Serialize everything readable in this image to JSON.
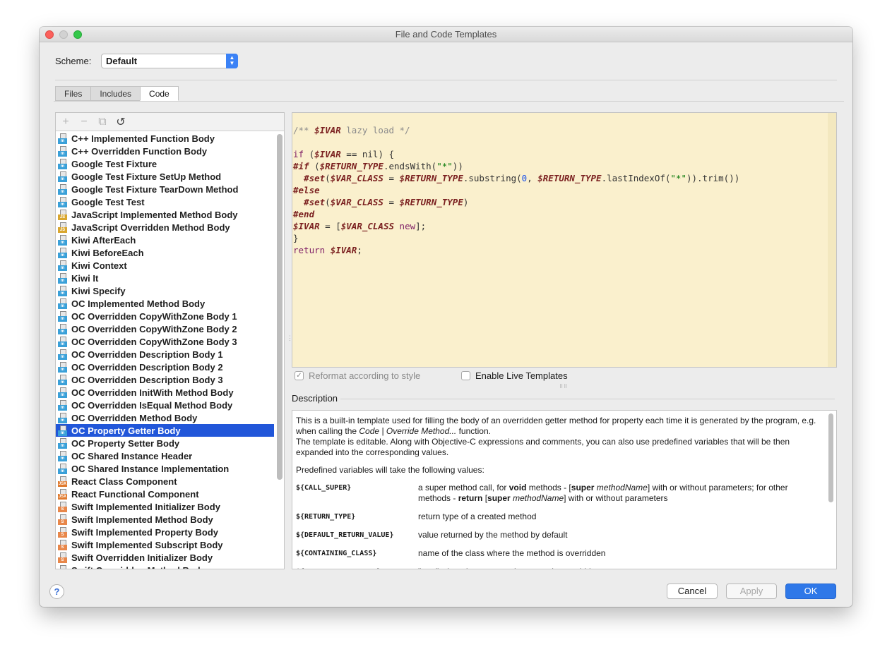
{
  "window": {
    "title": "File and Code Templates"
  },
  "scheme": {
    "label": "Scheme:",
    "value": "Default"
  },
  "tabs": [
    {
      "label": "Files",
      "active": false
    },
    {
      "label": "Includes",
      "active": false
    },
    {
      "label": "Code",
      "active": true
    }
  ],
  "toolbar": {
    "add": "+",
    "remove": "−",
    "copy": "⧉",
    "reset": "↺"
  },
  "templates": [
    {
      "label": "C++ Implemented Function Body",
      "icon": "m",
      "color": "#3aa0d8"
    },
    {
      "label": "C++ Overridden Function Body",
      "icon": "m",
      "color": "#3aa0d8"
    },
    {
      "label": "Google Test Fixture",
      "icon": "m",
      "color": "#3aa0d8"
    },
    {
      "label": "Google Test Fixture SetUp Method",
      "icon": "m",
      "color": "#3aa0d8"
    },
    {
      "label": "Google Test Fixture TearDown Method",
      "icon": "m",
      "color": "#3aa0d8"
    },
    {
      "label": "Google Test Test",
      "icon": "m",
      "color": "#3aa0d8"
    },
    {
      "label": "JavaScript Implemented Method Body",
      "icon": "JS",
      "color": "#d9a62e"
    },
    {
      "label": "JavaScript Overridden Method Body",
      "icon": "JS",
      "color": "#d9a62e"
    },
    {
      "label": "Kiwi AfterEach",
      "icon": "m",
      "color": "#3aa0d8"
    },
    {
      "label": "Kiwi BeforeEach",
      "icon": "m",
      "color": "#3aa0d8"
    },
    {
      "label": "Kiwi Context",
      "icon": "m",
      "color": "#3aa0d8"
    },
    {
      "label": "Kiwi It",
      "icon": "m",
      "color": "#3aa0d8"
    },
    {
      "label": "Kiwi Specify",
      "icon": "m",
      "color": "#3aa0d8"
    },
    {
      "label": "OC Implemented Method Body",
      "icon": "m",
      "color": "#3aa0d8"
    },
    {
      "label": "OC Overridden CopyWithZone Body 1",
      "icon": "m",
      "color": "#3aa0d8"
    },
    {
      "label": "OC Overridden CopyWithZone Body 2",
      "icon": "m",
      "color": "#3aa0d8"
    },
    {
      "label": "OC Overridden CopyWithZone Body 3",
      "icon": "m",
      "color": "#3aa0d8"
    },
    {
      "label": "OC Overridden Description Body 1",
      "icon": "m",
      "color": "#3aa0d8"
    },
    {
      "label": "OC Overridden Description Body 2",
      "icon": "m",
      "color": "#3aa0d8"
    },
    {
      "label": "OC Overridden Description Body 3",
      "icon": "m",
      "color": "#3aa0d8"
    },
    {
      "label": "OC Overridden InitWith Method Body",
      "icon": "m",
      "color": "#3aa0d8"
    },
    {
      "label": "OC Overridden IsEqual Method Body",
      "icon": "m",
      "color": "#3aa0d8"
    },
    {
      "label": "OC Overridden Method Body",
      "icon": "m",
      "color": "#3aa0d8"
    },
    {
      "label": "OC Property Getter Body",
      "icon": "m",
      "color": "#3aa0d8",
      "selected": true
    },
    {
      "label": "OC Property Setter Body",
      "icon": "m",
      "color": "#3aa0d8"
    },
    {
      "label": "OC Shared Instance Header",
      "icon": "m",
      "color": "#3aa0d8"
    },
    {
      "label": "OC Shared Instance Implementation",
      "icon": "m",
      "color": "#3aa0d8"
    },
    {
      "label": "React Class Component",
      "icon": "JSX",
      "color": "#e07a2e"
    },
    {
      "label": "React Functional Component",
      "icon": "JSX",
      "color": "#e07a2e"
    },
    {
      "label": "Swift Implemented Initializer Body",
      "icon": "S",
      "color": "#e8874a"
    },
    {
      "label": "Swift Implemented Method Body",
      "icon": "S",
      "color": "#e8874a"
    },
    {
      "label": "Swift Implemented Property Body",
      "icon": "S",
      "color": "#e8874a"
    },
    {
      "label": "Swift Implemented Subscript Body",
      "icon": "S",
      "color": "#e8874a"
    },
    {
      "label": "Swift Overridden Initializer Body",
      "icon": "S",
      "color": "#e8874a"
    },
    {
      "label": "Swift Overridden Method Body",
      "icon": "S",
      "color": "#e8874a"
    }
  ],
  "code_lines": [
    [
      [
        "cm",
        "/** "
      ],
      [
        "vr",
        "$IVAR"
      ],
      [
        "cm",
        " lazy load */"
      ]
    ],
    [],
    [
      [
        "kw",
        "if"
      ],
      [
        "pn",
        " ("
      ],
      [
        "vr",
        "$IVAR"
      ],
      [
        "pn",
        " == nil) {"
      ]
    ],
    [
      [
        "dv",
        "#if"
      ],
      [
        "pn",
        " ("
      ],
      [
        "vr",
        "$RETURN_TYPE"
      ],
      [
        "pn",
        ".endsWith("
      ],
      [
        "st",
        "\"*\""
      ],
      [
        "pn",
        "))"
      ]
    ],
    [
      [
        "pn",
        "  "
      ],
      [
        "dv",
        "#set"
      ],
      [
        "pn",
        "("
      ],
      [
        "vr",
        "$VAR_CLASS"
      ],
      [
        "pn",
        " = "
      ],
      [
        "vr",
        "$RETURN_TYPE"
      ],
      [
        "pn",
        ".substring("
      ],
      [
        "nm",
        "0"
      ],
      [
        "pn",
        ", "
      ],
      [
        "vr",
        "$RETURN_TYPE"
      ],
      [
        "pn",
        ".lastIndexOf("
      ],
      [
        "st",
        "\"*\""
      ],
      [
        "pn",
        ")).trim())"
      ]
    ],
    [
      [
        "dv",
        "#else"
      ]
    ],
    [
      [
        "pn",
        "  "
      ],
      [
        "dv",
        "#set"
      ],
      [
        "pn",
        "("
      ],
      [
        "vr",
        "$VAR_CLASS"
      ],
      [
        "pn",
        " = "
      ],
      [
        "vr",
        "$RETURN_TYPE"
      ],
      [
        "pn",
        ")"
      ]
    ],
    [
      [
        "dv",
        "#end"
      ]
    ],
    [
      [
        "vr",
        "$IVAR"
      ],
      [
        "pn",
        " = ["
      ],
      [
        "vr",
        "$VAR_CLASS"
      ],
      [
        "pn",
        " "
      ],
      [
        "kw",
        "new"
      ],
      [
        "pn",
        "];"
      ]
    ],
    [
      [
        "pn",
        "}"
      ]
    ],
    [
      [
        "kw",
        "return"
      ],
      [
        "pn",
        " "
      ],
      [
        "vr",
        "$IVAR"
      ],
      [
        "pn",
        ";"
      ]
    ]
  ],
  "options": {
    "reformat": {
      "label": "Reformat according to style",
      "checked": true,
      "disabled": true
    },
    "live_templates": {
      "label": "Enable Live Templates",
      "checked": false
    }
  },
  "description": {
    "label": "Description",
    "para1_a": "This is a built-in template used for filling the body of an overridden getter method for property each time it is generated by the program, e.g. when calling the ",
    "para1_em": "Code | Override Method...",
    "para1_b": " function.",
    "para2": "The template is editable. Along with Objective-C expressions and comments, you can also use predefined variables that will be then expanded into the corresponding values.",
    "para3": "Predefined variables will take the following values:",
    "vars": [
      {
        "name": "${CALL_SUPER}",
        "desc_parts": [
          [
            "t",
            "a super method call, for "
          ],
          [
            "b",
            "void"
          ],
          [
            "t",
            " methods - ["
          ],
          [
            "b",
            "super"
          ],
          [
            "t",
            " "
          ],
          [
            "i",
            "methodName"
          ],
          [
            "t",
            "] with or without parameters; for other methods - "
          ],
          [
            "b",
            "return"
          ],
          [
            "t",
            " ["
          ],
          [
            "b",
            "super"
          ],
          [
            "t",
            " "
          ],
          [
            "i",
            "methodName"
          ],
          [
            "t",
            "] with or without parameters"
          ]
        ]
      },
      {
        "name": "${RETURN_TYPE}",
        "desc_parts": [
          [
            "t",
            "return type of a created method"
          ]
        ]
      },
      {
        "name": "${DEFAULT_RETURN_VALUE}",
        "desc_parts": [
          [
            "t",
            "value returned by the method by default"
          ]
        ]
      },
      {
        "name": "${CONTAINING_CLASS}",
        "desc_parts": [
          [
            "t",
            "name of the class where the method is overridden"
          ]
        ]
      },
      {
        "name": "${IVAR_IS_AVAILABLE}",
        "desc_parts": [
          [
            "t",
            "\"true\" when the generated property is overridden"
          ]
        ]
      }
    ]
  },
  "buttons": {
    "help": "?",
    "cancel": "Cancel",
    "apply": "Apply",
    "ok": "OK"
  }
}
